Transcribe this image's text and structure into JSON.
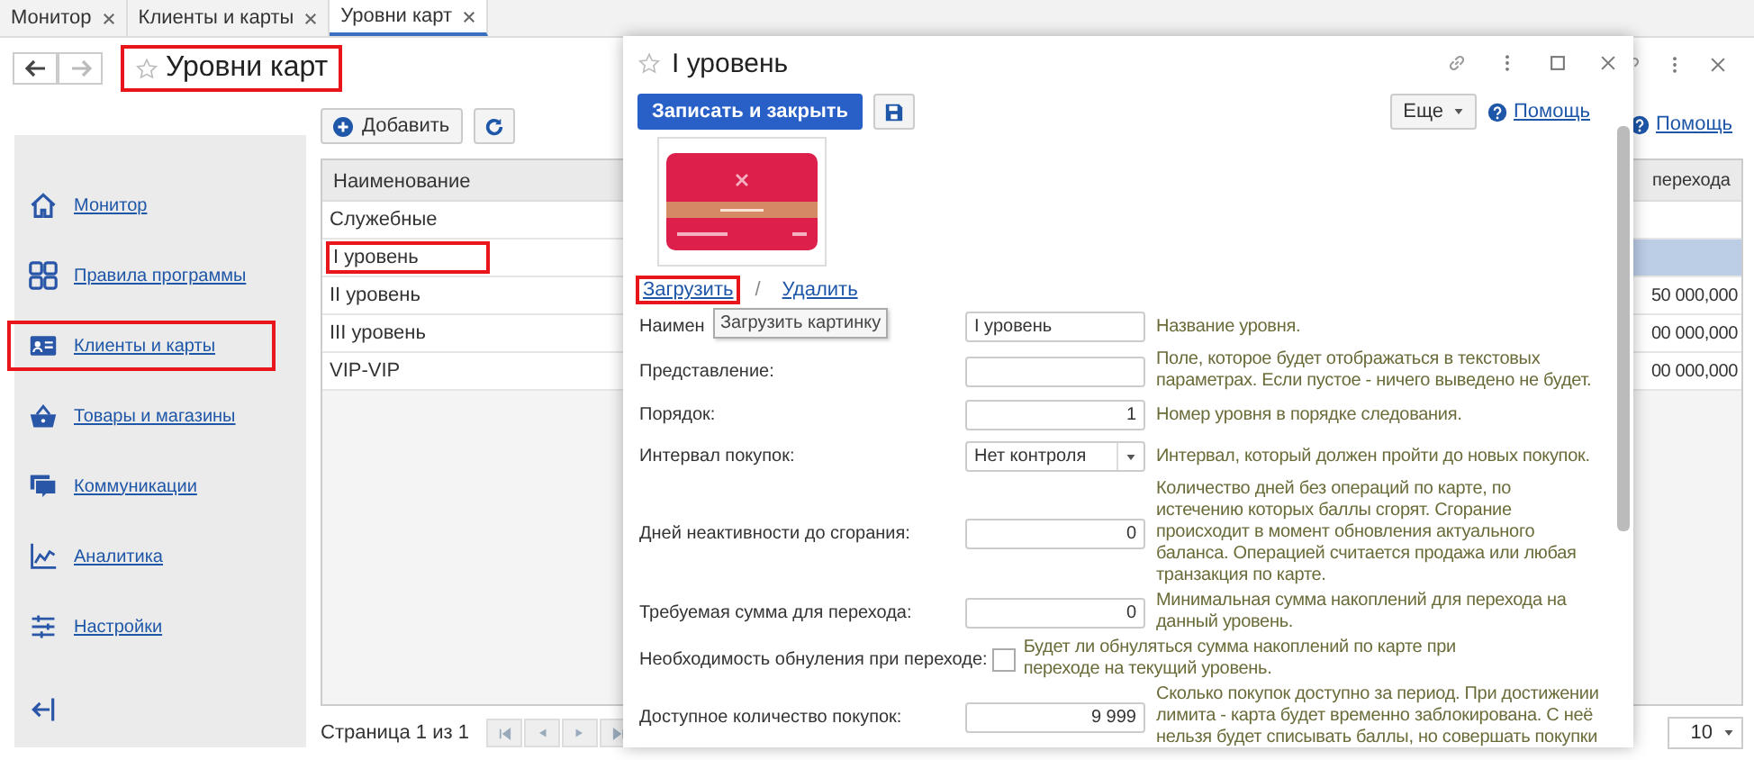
{
  "tabs": [
    {
      "label": "Монитор",
      "selected": false
    },
    {
      "label": "Клиенты и карты",
      "selected": false
    },
    {
      "label": "Уровни карт",
      "selected": true
    }
  ],
  "history_nav": [
    {
      "kind": "back",
      "disabled": false
    },
    {
      "kind": "forward",
      "disabled": true
    }
  ],
  "page": {
    "title": "Уровни карт",
    "highlighted": true,
    "help": "Помощь"
  },
  "sidebar": {
    "items": [
      {
        "label": "Монитор",
        "kind": "home",
        "highlighted": false
      },
      {
        "label": "Правила программы",
        "kind": "grid",
        "highlighted": false
      },
      {
        "label": "Клиенты и карты",
        "kind": "card",
        "highlighted": true
      },
      {
        "label": "Товары и магазины",
        "kind": "basket",
        "highlighted": false
      },
      {
        "label": "Коммуникации",
        "kind": "chat",
        "highlighted": false
      },
      {
        "label": "Аналитика",
        "kind": "chart",
        "highlighted": false
      },
      {
        "label": "Настройки",
        "kind": "sliders",
        "highlighted": false
      }
    ]
  },
  "list": {
    "add_button": "Добавить",
    "columns": [
      "Наименование",
      "перехода"
    ],
    "rows": [
      {
        "name": "Служебные",
        "selected": false,
        "highlighted": false
      },
      {
        "name": "I уровень",
        "selected": true,
        "highlighted": true
      },
      {
        "name": "II уровень",
        "column_2": "50 000,000",
        "selected": false,
        "highlighted": false
      },
      {
        "name": "III уровень",
        "column_2": "00 000,000",
        "selected": false,
        "highlighted": false
      },
      {
        "name": "VIP-VIP",
        "column_2": "00 000,000",
        "selected": false,
        "highlighted": false
      }
    ]
  },
  "pager": {
    "text": "Страница 1 из 1",
    "page_size": "10"
  },
  "dialog": {
    "title": "I уровень",
    "save_close_button": "Записать и закрыть",
    "more_button": "Еще",
    "help": "Помощь",
    "upload_link": {
      "label": "Загрузить",
      "highlighted": true
    },
    "delete_link": "Удалить",
    "separator": "/",
    "tooltip": "Загрузить картинку",
    "fields": [
      {
        "kind": "text",
        "label": "Наимен",
        "value": "I уровень",
        "hint": "Название уровня."
      },
      {
        "kind": "text",
        "label": "Представление:",
        "hint": "Поле, которое будет отображаться в текстовых параметрах. Если пустое - ничего выведено не будет."
      },
      {
        "kind": "number",
        "label": "Порядок:",
        "value": "1",
        "hint": "Номер уровня в порядке следования."
      },
      {
        "kind": "select",
        "label": "Интервал покупок:",
        "value": "Нет контроля",
        "hint": "Интервал, который должен пройти до новых покупок."
      },
      {
        "kind": "number",
        "label": "Дней неактивности до сгорания:",
        "value": "0",
        "hint": "Количество дней без операций по карте, по истечению которых баллы сгорят. Сгорание происходит в момент обновления актуального баланса. Операцией считается продажа или любая транзакция по карте."
      },
      {
        "kind": "number",
        "label": "Требуемая сумма для перехода:",
        "value": "0",
        "hint": "Минимальная сумма накоплений для перехода на данный уровень."
      },
      {
        "kind": "checkbox",
        "label": "Необходимость обнуления при переходе:",
        "checked": false,
        "hint": "Будет ли обнуляться сумма накоплений по карте при переходе на текущий уровень."
      },
      {
        "kind": "number",
        "label": "Доступное количество покупок:",
        "value": "9 999",
        "hint": "Сколько покупок доступно за период. При достижении лимита - карта будет временно заблокирована. С неё нельзя будет списывать баллы, но совершать покупки"
      }
    ]
  }
}
